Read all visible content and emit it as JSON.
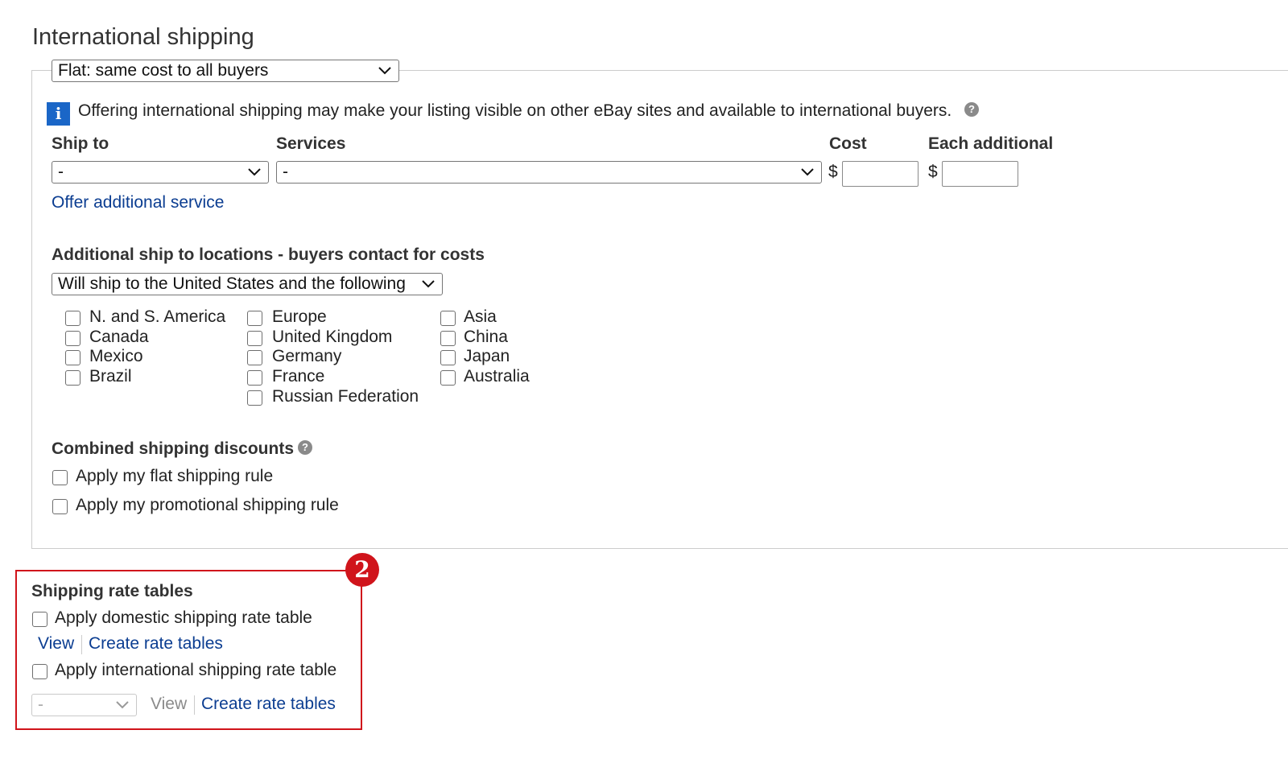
{
  "section": {
    "title": "International shipping",
    "shipping_type": {
      "selected": "Flat: same cost to all buyers"
    }
  },
  "info": {
    "icon": "info-icon",
    "text": "Offering international shipping may make your listing visible on other eBay sites and available to international buyers.",
    "help_icon": "help-icon",
    "help_glyph": "?"
  },
  "service_table": {
    "headers": {
      "ship_to": "Ship to",
      "services": "Services",
      "cost": "Cost",
      "each_additional": "Each additional"
    },
    "ship_to_selected": "-",
    "services_selected": "-",
    "currency": "$",
    "cost_value": "",
    "each_additional_value": "",
    "offer_additional_link": "Offer additional service"
  },
  "additional_locations": {
    "title": "Additional ship to locations - buyers contact for costs",
    "selected": "Will ship to the United States and the following",
    "columns": [
      [
        "N. and S. America",
        "Canada",
        "Mexico",
        "Brazil"
      ],
      [
        "Europe",
        "United Kingdom",
        "Germany",
        "France",
        "Russian Federation"
      ],
      [
        "Asia",
        "China",
        "Japan",
        "Australia"
      ]
    ]
  },
  "combined_discounts": {
    "title": "Combined shipping discounts",
    "options": [
      "Apply my flat shipping rule",
      "Apply my promotional shipping rule"
    ]
  },
  "rate_tables": {
    "title": "Shipping rate tables",
    "domestic_label": "Apply domestic shipping rate table",
    "domestic_view": "View",
    "domestic_create": "Create rate tables",
    "international_label": "Apply international shipping rate table",
    "international_selected": "-",
    "international_view": "View",
    "international_create": "Create rate tables"
  },
  "annotation": {
    "badge": "2",
    "color": "#d0141b"
  },
  "colors": {
    "link": "#0b3d91",
    "info_icon": "#1a66c7",
    "highlight": "#d0141b"
  }
}
